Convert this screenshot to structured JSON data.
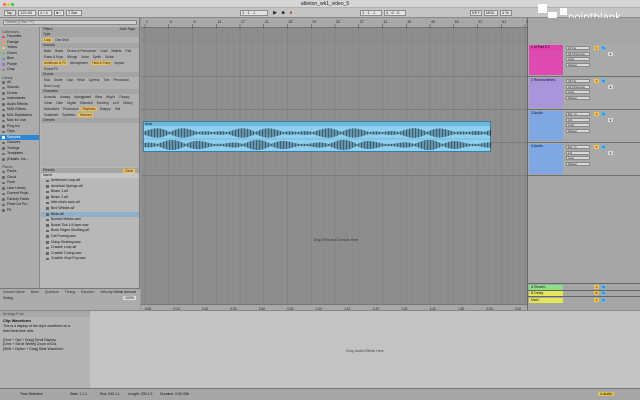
{
  "window": {
    "title": "ableton_wk1_video_5",
    "traffic_colors": [
      "#fe5f57",
      "#febc2e",
      "#28c840"
    ]
  },
  "transport": {
    "tap": "Tap",
    "tempo": "120.00",
    "time_sig": "4 / 4",
    "metronome": "●○",
    "quantize": "1 Bar",
    "position": "1 . 1 . 1",
    "loop_start": "1 . 1 . 1",
    "loop_length": "4 . 0 . 0",
    "play_icon": "play-icon",
    "stop_icon": "stop-icon",
    "record_icon": "record-icon",
    "key": "KEY",
    "midi": "MIDI",
    "cpu": "4 %"
  },
  "logo": {
    "text": "pointblank"
  },
  "browser": {
    "search_placeholder": "Search (Cmd + F)",
    "collections_header": "Collections",
    "collections": [
      {
        "label": "Favorites",
        "color": "#e0457b"
      },
      {
        "label": "Orange",
        "color": "#f39c3b"
      },
      {
        "label": "Yellow",
        "color": "#e9d54a"
      },
      {
        "label": "Green",
        "color": "#69c56b"
      },
      {
        "label": "Blue",
        "color": "#3f8fe0"
      },
      {
        "label": "Purple",
        "color": "#a06be0"
      },
      {
        "label": "Gray",
        "color": "#8a8a8a"
      }
    ],
    "library_header": "Library",
    "library": [
      {
        "label": "All",
        "selected": false
      },
      {
        "label": "Sounds",
        "selected": false
      },
      {
        "label": "Drums",
        "selected": false
      },
      {
        "label": "Instruments",
        "selected": false
      },
      {
        "label": "Audio Effects",
        "selected": false
      },
      {
        "label": "MIDI Effects",
        "selected": false
      },
      {
        "label": "M4L Modulators",
        "selected": false
      },
      {
        "label": "Max for Live",
        "selected": false
      },
      {
        "label": "Plug-Ins",
        "selected": false
      },
      {
        "label": "Clips",
        "selected": false
      },
      {
        "label": "Samples",
        "selected": true
      },
      {
        "label": "Grooves",
        "selected": false
      },
      {
        "label": "Tunings",
        "selected": false
      },
      {
        "label": "Templates",
        "selected": false
      },
      {
        "label": "(Details, Ins...",
        "selected": false
      }
    ],
    "places_header": "Places",
    "places": [
      "Packs",
      "Cloud",
      "Push",
      "User Library",
      "Current Proje...",
      "Factory Packs",
      "Final Cut Pro",
      "P8"
    ],
    "filters_label": "Filters",
    "auto_tags_label": "Auto Tags",
    "tag_groups": [
      {
        "title": "Type",
        "tags": [
          {
            "t": "Loop",
            "on": true
          },
          {
            "t": "One Shot",
            "on": false
          }
        ]
      },
      {
        "title": "Sounds",
        "tags": [
          {
            "t": "Bass",
            "on": false
          },
          {
            "t": "Brass",
            "on": false
          },
          {
            "t": "Drums & Percussion",
            "on": false
          },
          {
            "t": "Lead",
            "on": false
          },
          {
            "t": "Mallets",
            "on": false
          },
          {
            "t": "Pad",
            "on": false
          },
          {
            "t": "Piano & Keys",
            "on": false
          },
          {
            "t": "Strings",
            "on": false
          },
          {
            "t": "Voice",
            "on": false
          },
          {
            "t": "Synth",
            "on": false
          },
          {
            "t": "Guitar",
            "on": false
          },
          {
            "t": "Ambience & FX",
            "on": true
          },
          {
            "t": "Atmospheric",
            "on": false
          },
          {
            "t": "Field & Foley",
            "on": true
          },
          {
            "t": "Impact",
            "on": false
          },
          {
            "t": "Sound FX",
            "on": false
          }
        ]
      },
      {
        "title": "Drums",
        "tags": [
          {
            "t": "Kick",
            "on": false
          },
          {
            "t": "Snare",
            "on": false
          },
          {
            "t": "Clap",
            "on": false
          },
          {
            "t": "Hihat",
            "on": false
          },
          {
            "t": "Cymbal",
            "on": false
          },
          {
            "t": "Tom",
            "on": false
          },
          {
            "t": "Percussion",
            "on": false
          },
          {
            "t": "Drum Loop",
            "on": false
          }
        ]
      },
      {
        "title": "Character",
        "tags": [
          {
            "t": "Acoustic",
            "on": false
          },
          {
            "t": "Analog",
            "on": false
          },
          {
            "t": "Arpeggiated",
            "on": false
          },
          {
            "t": "Bass",
            "on": false
          },
          {
            "t": "Bright",
            "on": false
          },
          {
            "t": "Choppy",
            "on": false
          },
          {
            "t": "Clean",
            "on": false
          },
          {
            "t": "Dark",
            "on": false
          },
          {
            "t": "Digital",
            "on": false
          },
          {
            "t": "Distorted",
            "on": false
          },
          {
            "t": "Evolving",
            "on": false
          },
          {
            "t": "Lo-fi",
            "on": false
          },
          {
            "t": "Glitchy",
            "on": false
          },
          {
            "t": "Modulated",
            "on": false
          },
          {
            "t": "Percussive",
            "on": false
          },
          {
            "t": "Rhythmic",
            "on": true
          },
          {
            "t": "Snappy",
            "on": false
          },
          {
            "t": "Soft",
            "on": false
          },
          {
            "t": "Sustained",
            "on": false
          },
          {
            "t": "Synthetic",
            "on": false
          },
          {
            "t": "Textured",
            "on": true
          }
        ]
      },
      {
        "title": "Genres",
        "tags": []
      }
    ],
    "results_header": "Results",
    "results_clear": "Clear",
    "name_col": "Name",
    "results": [
      {
        "label": "Ambience Loop.aif",
        "selected": false
      },
      {
        "label": "Armchair Springs.aif",
        "selected": false
      },
      {
        "label": "Beam 1.aif",
        "selected": false
      },
      {
        "label": "Beam 2.aif",
        "selected": false
      },
      {
        "label": "bike chain sack.aif",
        "selected": false
      },
      {
        "label": "Bird Whistle.aif",
        "selected": false
      },
      {
        "label": "Birds.aif",
        "selected": true
      },
      {
        "label": "Bowled Metals.wav",
        "selected": false
      },
      {
        "label": "Bowie Tick 1/4 bpm.wav",
        "selected": false
      },
      {
        "label": "Book Pages Shuffling.aif",
        "selected": false
      },
      {
        "label": "Cat Purring.wav",
        "selected": false
      },
      {
        "label": "Clasp Shaking.wav",
        "selected": false
      },
      {
        "label": "Crackle Loop.aif",
        "selected": false
      },
      {
        "label": "Crackle Tuning.wav",
        "selected": false
      },
      {
        "label": "Crackle Vinyl Pop.wav",
        "selected": false
      }
    ],
    "results_footer": "1 item selected",
    "groove_cols": [
      "Groove Name",
      "Base",
      "Quantize",
      "Timing",
      "Random",
      "Velocity"
    ],
    "groove_row": "Swing",
    "global_amount_label": "Global Amount",
    "global_amount": "100%"
  },
  "info_view": {
    "header": "Arrange Pool",
    "title": "Clip Waveform",
    "lines": [
      "This is a display of the clip's waveform on a",
      "fixed beat-time axis.",
      "",
      "[Cmd + Opt + Drag] Scroll Display",
      "[Cmd + Scroll Wheel] Zoom In/Out",
      "[Shift + Option + Drag] Slide Waveform"
    ]
  },
  "arrangement": {
    "ruler_bars": [
      "1",
      "5",
      "9",
      "13",
      "17",
      "21",
      "25",
      "29",
      "33",
      "37",
      "41",
      "45",
      "49",
      "53",
      "57",
      "61",
      "65"
    ],
    "time_marks": [
      "0:00",
      "0:10",
      "0:20",
      "0:30",
      "0:40",
      "0:50",
      "1:00",
      "1:10",
      "1:20",
      "1:30",
      "1:40",
      "1:50",
      "2:00",
      "2:10"
    ],
    "clip_name": "Birds",
    "clip_color": "#8dd0ef",
    "drop_text": "Drop Files and Devices Here"
  },
  "tracks": [
    {
      "name": "1 Id Pad 0 1",
      "color": "#e23fb0",
      "input": "All Ins",
      "channel": "All Channels",
      "monitor": "Auto",
      "output": "Master",
      "number": "1"
    },
    {
      "name": "2 Reconchimes",
      "color": "#a992de",
      "input": "All Ins",
      "channel": "All Channels",
      "monitor": "Auto",
      "output": "Master",
      "number": "2"
    },
    {
      "name": "3 Audio",
      "color": "#7aa7e8",
      "input": "Ext. In",
      "channel": "1/2",
      "monitor": "Auto",
      "output": "Master",
      "number": "3"
    },
    {
      "name": "4 Audio",
      "color": "#7aa7e8",
      "input": "Ext. In",
      "channel": "1/2",
      "monitor": "Auto",
      "output": "Master",
      "number": "4"
    }
  ],
  "returns": [
    {
      "name": "A Reverb",
      "color": "#8de08a",
      "letter": "A"
    },
    {
      "name": "B Delay",
      "color": "#e5e55a",
      "letter": "B"
    },
    {
      "name": "Main",
      "color": "#e5e55a",
      "letter": "0"
    }
  ],
  "device": {
    "drop_text": "Drop Audio Effects Here"
  },
  "status": {
    "selection": "Time Selection",
    "start": "Start: 1.1.1",
    "end": "End: 240.1.1",
    "length": "Length: 239.1.0",
    "duration": "Duration: 2:00:336",
    "track": "4-Audio"
  }
}
